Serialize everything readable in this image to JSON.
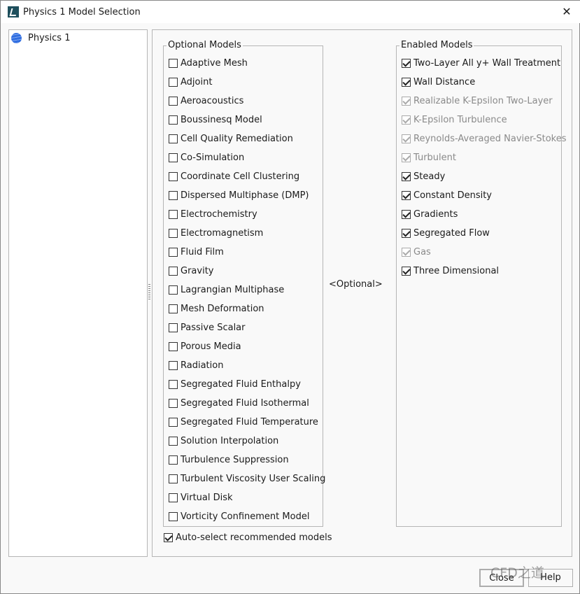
{
  "window": {
    "title": "Physics 1 Model Selection"
  },
  "tree": {
    "items": [
      {
        "label": "Physics 1"
      }
    ]
  },
  "optional": {
    "label": "Optional Models",
    "items": [
      "Adaptive Mesh",
      "Adjoint",
      "Aeroacoustics",
      "Boussinesq Model",
      "Cell Quality Remediation",
      "Co-Simulation",
      "Coordinate Cell Clustering",
      "Dispersed Multiphase (DMP)",
      "Electrochemistry",
      "Electromagnetism",
      "Fluid Film",
      "Gravity",
      "Lagrangian Multiphase",
      "Mesh Deformation",
      "Passive Scalar",
      "Porous Media",
      "Radiation",
      "Segregated Fluid Enthalpy",
      "Segregated Fluid Isothermal",
      "Segregated Fluid Temperature",
      "Solution Interpolation",
      "Turbulence Suppression",
      "Turbulent Viscosity User Scaling",
      "Virtual Disk",
      "Vorticity Confinement Model"
    ]
  },
  "middle": {
    "label": "<Optional>"
  },
  "enabled": {
    "label": "Enabled Models",
    "items": [
      {
        "label": "Two-Layer All y+ Wall Treatment",
        "checked": true,
        "disabled": false
      },
      {
        "label": "Wall Distance",
        "checked": true,
        "disabled": false
      },
      {
        "label": "Realizable K-Epsilon Two-Layer",
        "checked": true,
        "disabled": true
      },
      {
        "label": "K-Epsilon Turbulence",
        "checked": true,
        "disabled": true
      },
      {
        "label": "Reynolds-Averaged Navier-Stokes",
        "checked": true,
        "disabled": true
      },
      {
        "label": "Turbulent",
        "checked": true,
        "disabled": true
      },
      {
        "label": "Steady",
        "checked": true,
        "disabled": false
      },
      {
        "label": "Constant Density",
        "checked": true,
        "disabled": false
      },
      {
        "label": "Gradients",
        "checked": true,
        "disabled": false
      },
      {
        "label": "Segregated Flow",
        "checked": true,
        "disabled": false
      },
      {
        "label": "Gas",
        "checked": true,
        "disabled": true
      },
      {
        "label": "Three Dimensional",
        "checked": true,
        "disabled": false
      }
    ]
  },
  "auto_select": {
    "label": "Auto-select recommended models",
    "checked": true
  },
  "buttons": {
    "close": "Close",
    "help": "Help"
  },
  "watermark": "CFD之道"
}
